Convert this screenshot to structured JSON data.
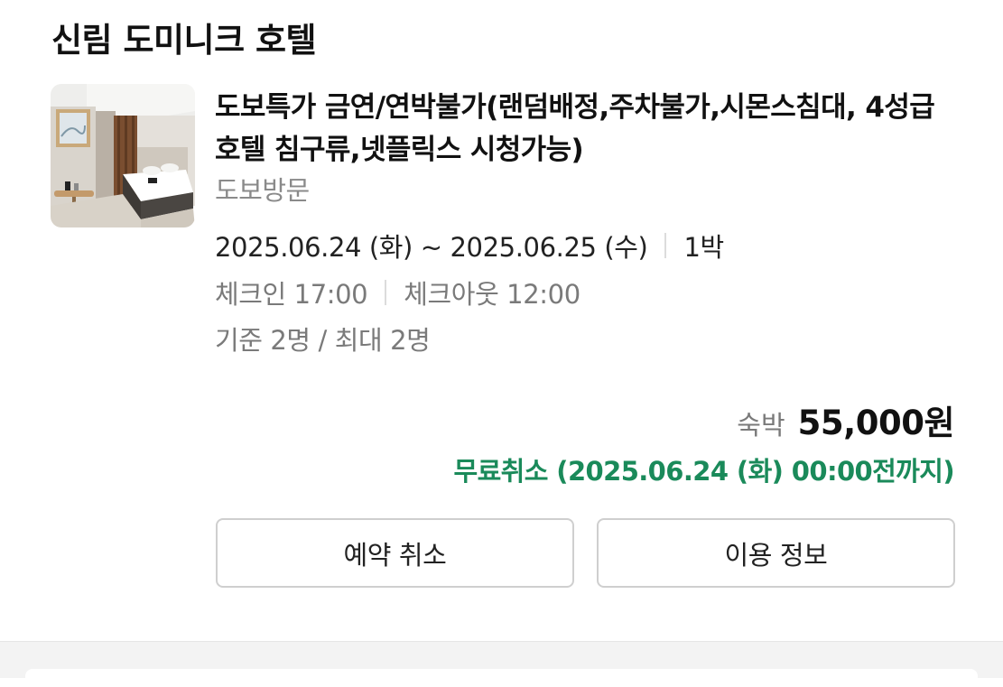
{
  "reservation": {
    "hotel_name": "신림 도미니크 호텔",
    "room_title": "도보특가 금연/연박불가(랜덤배정,주차불가,시몬스침대, 4성급 호텔 침구류,넷플릭스 시청가능)",
    "visit_type": "도보방문",
    "dates": "2025.06.24 (화) ~ 2025.06.25 (수)",
    "nights": "1박",
    "check_in": "체크인 17:00",
    "check_out": "체크아웃 12:00",
    "guests": "기준 2명 / 최대 2명",
    "price_label": "숙박",
    "price": "55,000원",
    "free_cancel": "무료취소 (2025.06.24 (화) 00:00전까지)",
    "free_cancel_color": "#1a8a5a"
  },
  "actions": {
    "cancel_label": "예약 취소",
    "info_label": "이용 정보"
  },
  "icons": {
    "thumbnail": "hotel-room-photo"
  }
}
